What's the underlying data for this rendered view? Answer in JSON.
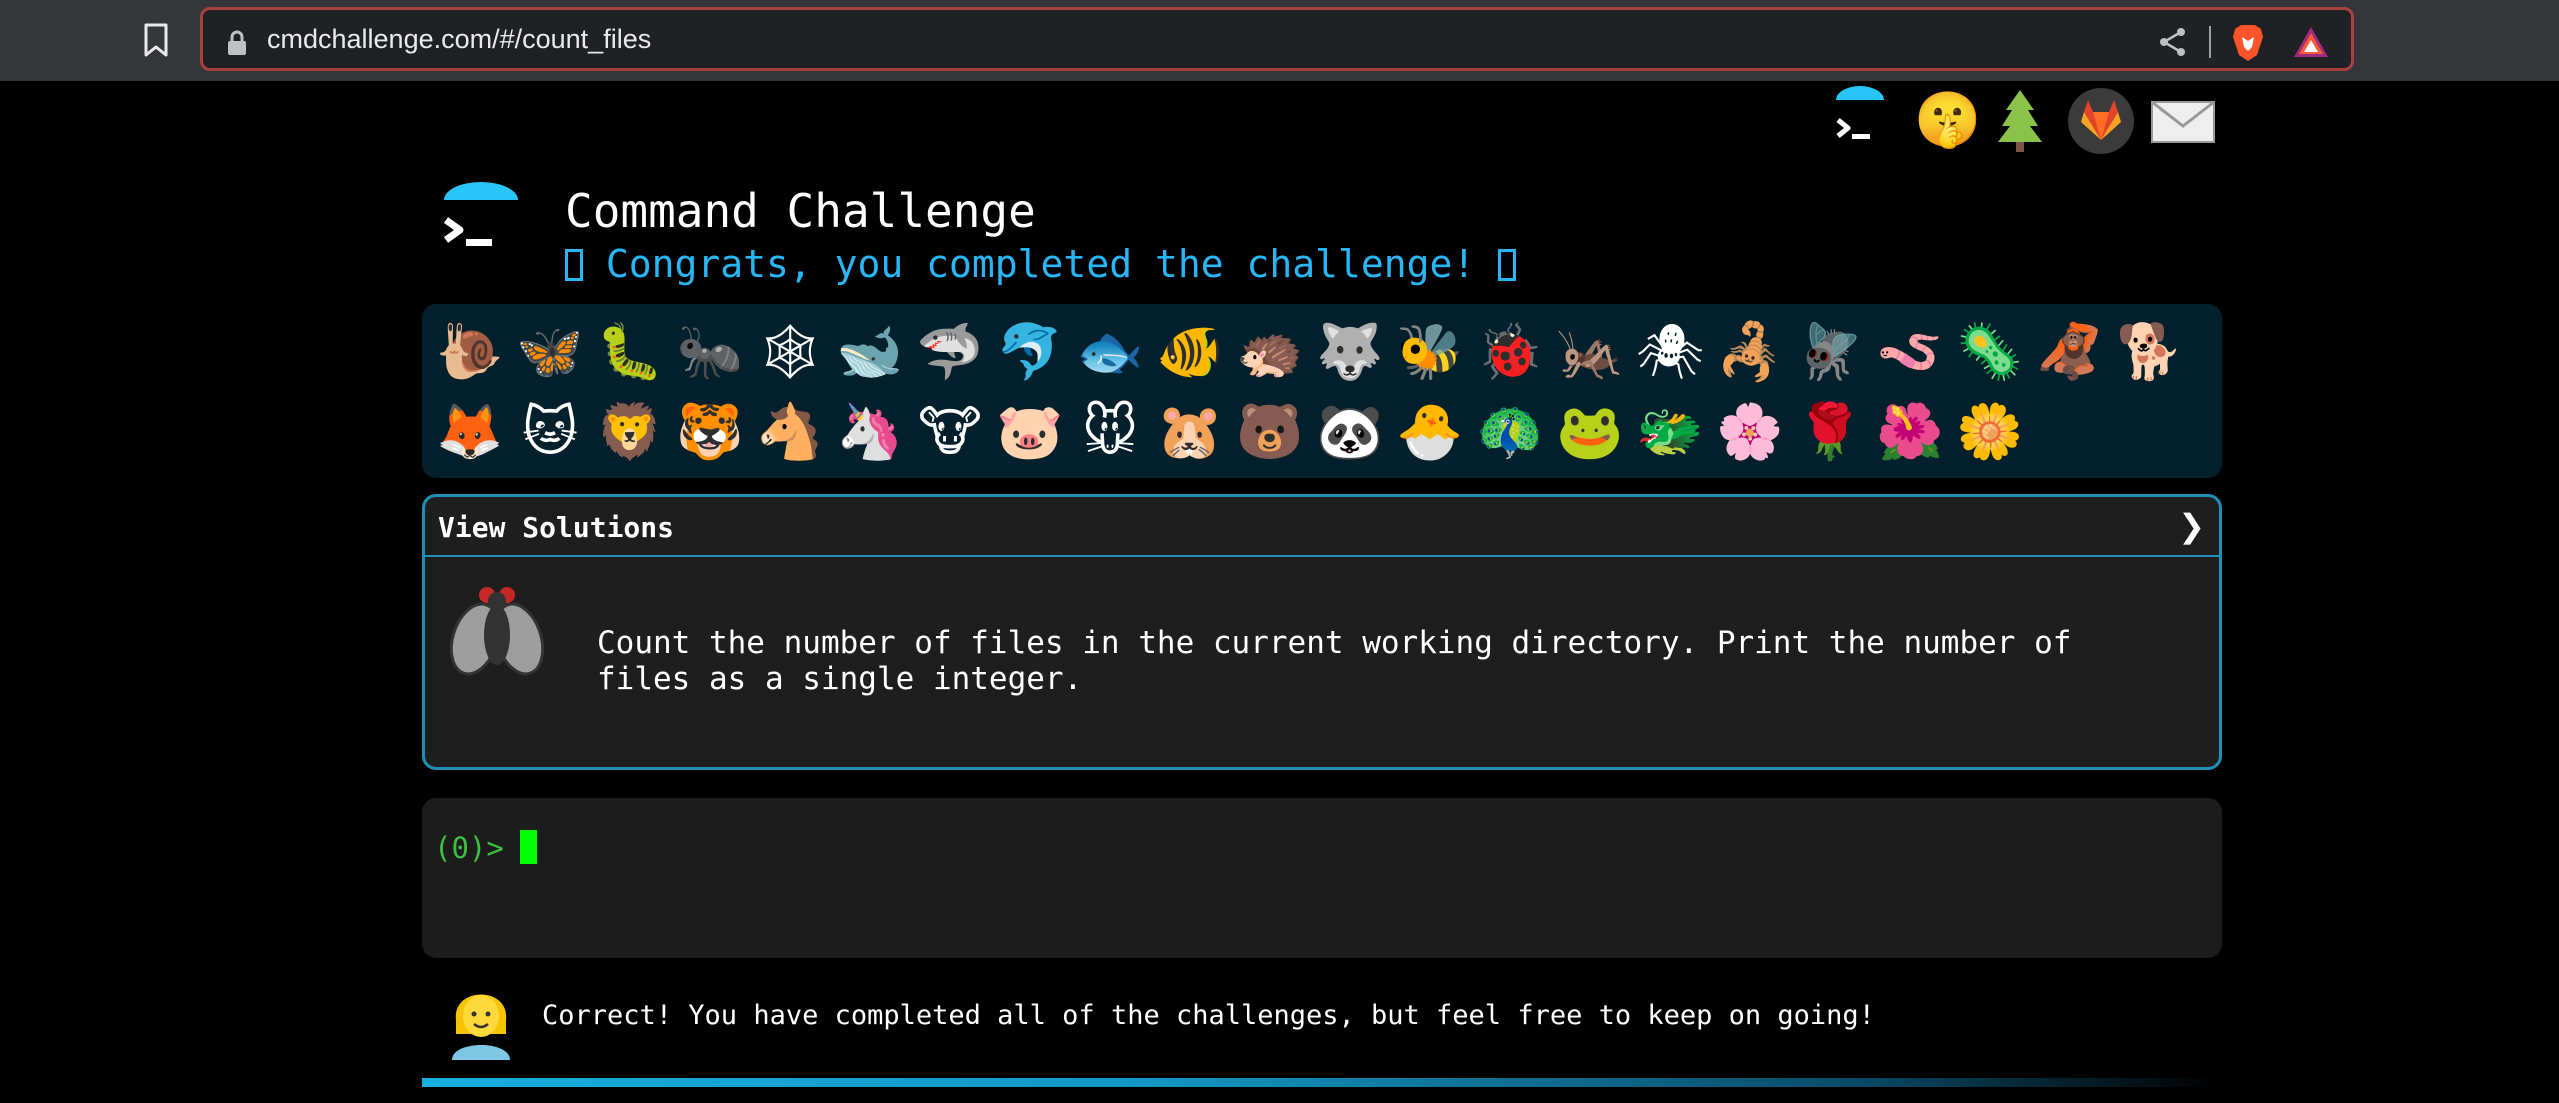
{
  "browser": {
    "url": "cmdchallenge.com/#/count_files",
    "icons": [
      "bookmark-icon",
      "lock-icon",
      "share-icon",
      "brave-shield-icon",
      "brave-rewards-icon"
    ]
  },
  "top_links": [
    {
      "name": "cmdchallenge-logo-link",
      "icon": "terminal-logo-icon"
    },
    {
      "name": "shushing-face-link",
      "icon": "🤫"
    },
    {
      "name": "tree-link",
      "icon": "tree-icon"
    },
    {
      "name": "gitlab-link",
      "icon": "gitlab-fox-icon"
    },
    {
      "name": "mail-link",
      "icon": "envelope-icon"
    }
  ],
  "header": {
    "title": "Command Challenge",
    "subtitle": " Congrats, you completed the challenge! "
  },
  "emoji_grid": {
    "row1": [
      "🐌",
      "🦋",
      "🐛",
      "🐜",
      "🕸",
      "🐋",
      "🦈",
      "🐬",
      "🐟",
      "🐠",
      "🦔",
      "🐺",
      "🐝",
      "🐞",
      "🦗",
      "🕷",
      "🦂",
      "🪰",
      "🪱",
      "🦠",
      "🦧",
      "🐕"
    ],
    "row2": [
      "🦊",
      "🐱",
      "🦁",
      "🐯",
      "🐴",
      "🦄",
      "🐮",
      "🐷",
      "🐭",
      "🐹",
      "🐻",
      "🐼",
      "🐣",
      "🦚",
      "🐸",
      "🐲",
      "🌸",
      "🌹",
      "🌺",
      "🌼"
    ]
  },
  "solutions": {
    "label": "View Solutions",
    "chevron": "❯",
    "description": "Count the number of files in the current working directory. Print the number of\nfiles as a single integer."
  },
  "terminal": {
    "prompt": "(0)> "
  },
  "feedback": {
    "text": "Correct! You have completed all of the challenges, but feel free to keep on going!"
  },
  "progress": {
    "value": 1.0
  },
  "colors": {
    "accent": "#29b6f6",
    "prompt_green": "#3fbf3f",
    "cursor": "#00ff00",
    "url_border": "#a8413f"
  }
}
